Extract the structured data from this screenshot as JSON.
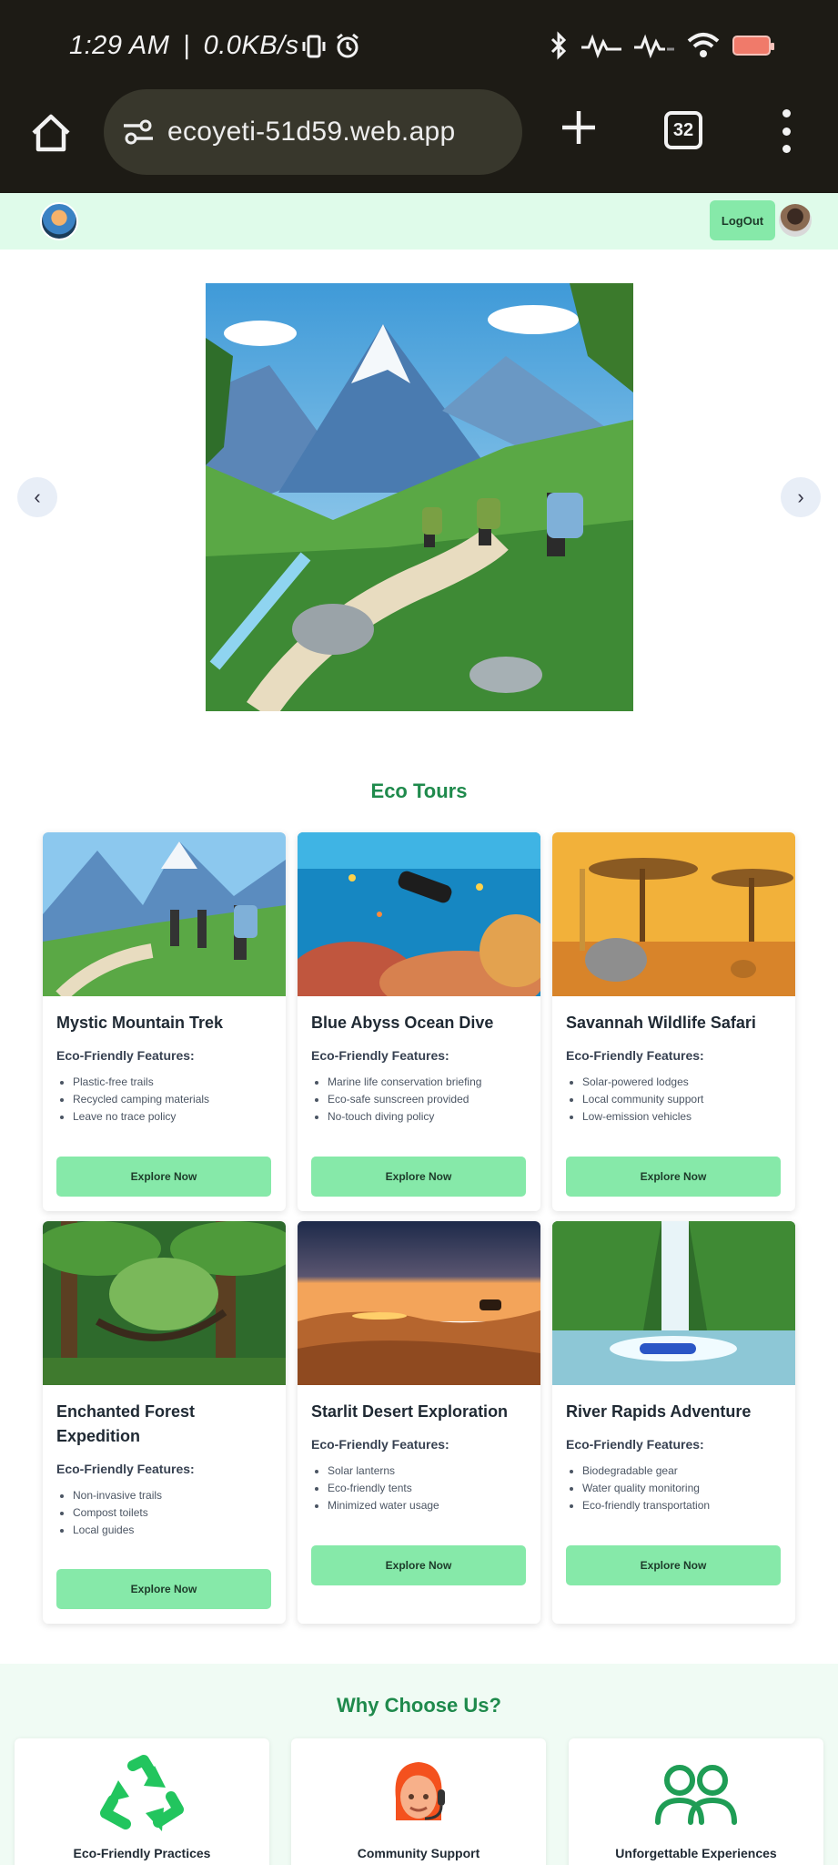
{
  "status_bar": {
    "time": "1:29 AM",
    "separator": "|",
    "net_speed": "0.0KB/s"
  },
  "browser": {
    "url": "ecoyeti-51d59.web.app",
    "tab_count": "32"
  },
  "header": {
    "logout_label": "LogOut"
  },
  "carousel": {
    "prev": "‹",
    "next": "›"
  },
  "tours": {
    "title": "Eco Tours",
    "features_heading": "Eco-Friendly Features:",
    "button_label": "Explore Now",
    "items": [
      {
        "title": "Mystic Mountain Trek",
        "features": [
          "Plastic-free trails",
          "Recycled camping materials",
          "Leave no trace policy"
        ]
      },
      {
        "title": "Blue Abyss Ocean Dive",
        "features": [
          "Marine life conservation briefing",
          "Eco-safe sunscreen provided",
          "No-touch diving policy"
        ]
      },
      {
        "title": "Savannah Wildlife Safari",
        "features": [
          "Solar-powered lodges",
          "Local community support",
          "Low-emission vehicles"
        ]
      },
      {
        "title": "Enchanted Forest Expedition",
        "features": [
          "Non-invasive trails",
          "Compost toilets",
          "Local guides"
        ]
      },
      {
        "title": "Starlit Desert Exploration",
        "features": [
          "Solar lanterns",
          "Eco-friendly tents",
          "Minimized water usage"
        ]
      },
      {
        "title": "River Rapids Adventure",
        "features": [
          "Biodegradable gear",
          "Water quality monitoring",
          "Eco-friendly transportation"
        ]
      }
    ]
  },
  "why": {
    "title": "Why Choose Us?",
    "items": [
      {
        "label": "Eco-Friendly Practices",
        "icon": "recycle-icon"
      },
      {
        "label": "Community Support",
        "icon": "support-agent-icon"
      },
      {
        "label": "Unforgettable Experiences",
        "icon": "users-icon"
      }
    ]
  },
  "colors": {
    "accent_green": "#1f8a4c",
    "button_green": "#86e9a9",
    "header_bg": "#dffbea"
  }
}
